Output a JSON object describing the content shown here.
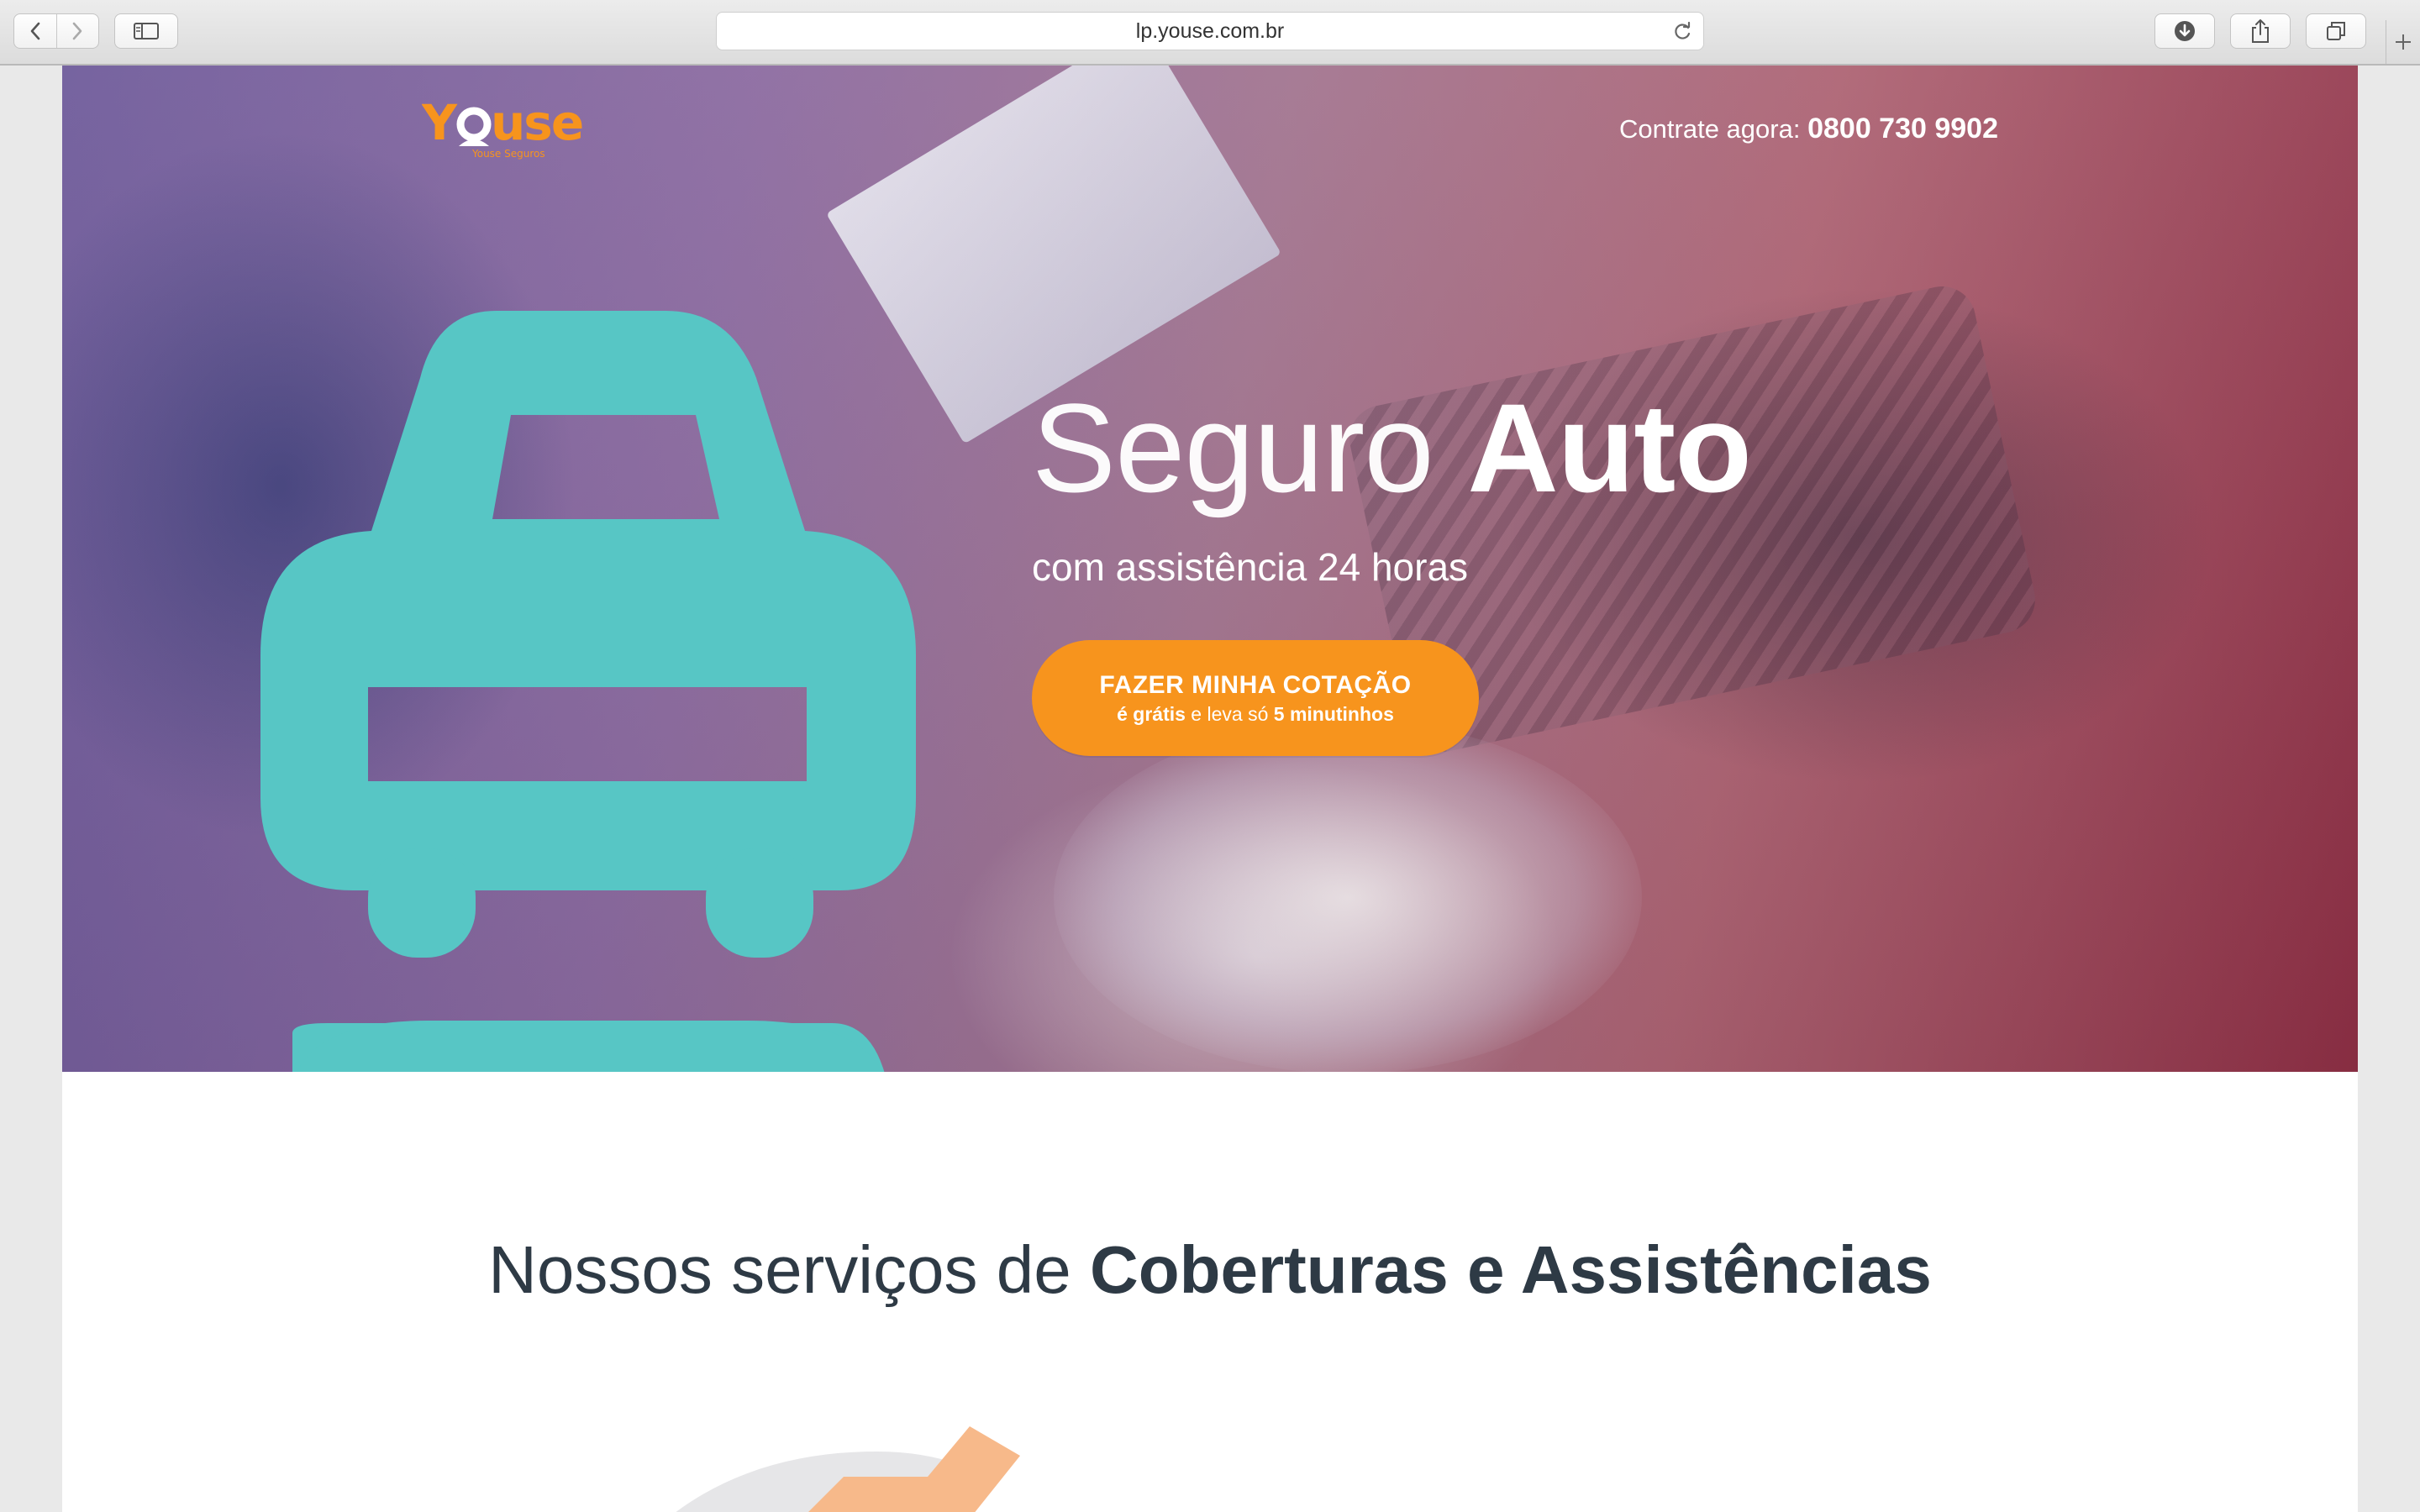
{
  "browser": {
    "url": "lp.youse.com.br",
    "icons": {
      "back": "chevron-left-icon",
      "forward": "chevron-right-icon",
      "sidebar": "sidebar-icon",
      "reload": "reload-icon",
      "downloads": "download-icon",
      "share": "share-icon",
      "tabs": "tabs-icon",
      "new_tab": "plus-icon"
    }
  },
  "header": {
    "logo_text": "YOUSE",
    "logo_tagline": "Youse Seguros",
    "phone_label": "Contrate agora:",
    "phone_number": "0800 730 9902"
  },
  "hero": {
    "title_light": "Seguro ",
    "title_bold": "Auto",
    "subtitle": "com assistência 24 horas",
    "cta_main": "FAZER MINHA COTAÇÃO",
    "cta_sub_bold1": "é grátis",
    "cta_sub_mid": " e leva só ",
    "cta_sub_bold2": "5 minutinhos"
  },
  "services": {
    "title_light": "Nossos serviços de ",
    "title_bold": "Coberturas e Assistências"
  },
  "colors": {
    "accent_orange": "#f7941d",
    "car_icon_teal": "#57c6c5",
    "heading_dark": "#2e3a45"
  }
}
